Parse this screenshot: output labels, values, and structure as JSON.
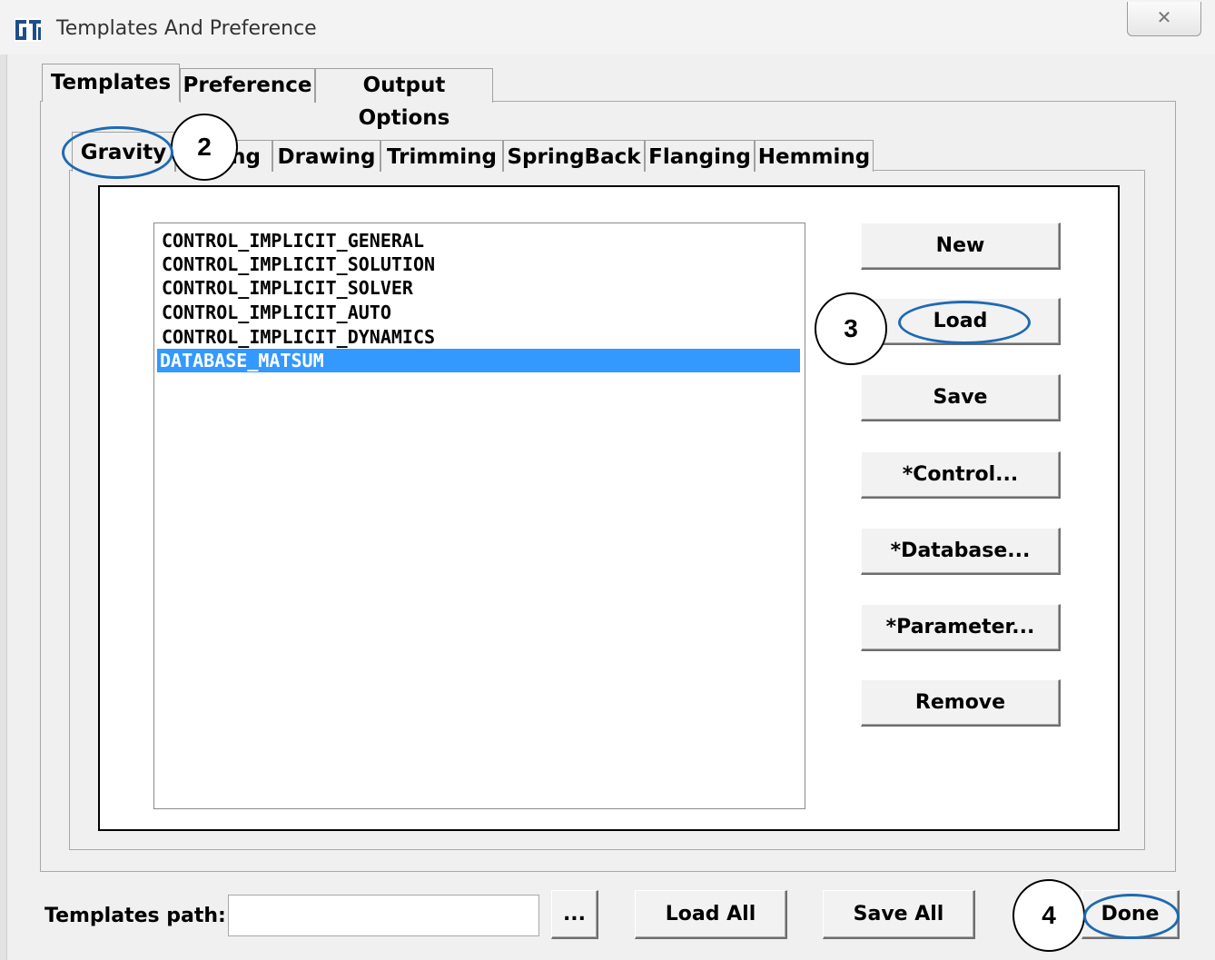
{
  "window": {
    "title": "Templates And Preference",
    "close_glyph": "✕"
  },
  "top_tabs": [
    {
      "label": "Templates",
      "active": true
    },
    {
      "label": "Preference",
      "active": false
    },
    {
      "label": "Output Options",
      "active": false
    }
  ],
  "sub_tabs": [
    {
      "label": "Gravity",
      "active": true
    },
    {
      "label": "ng",
      "active": false
    },
    {
      "label": "Drawing",
      "active": false
    },
    {
      "label": "Trimming",
      "active": false
    },
    {
      "label": "SpringBack",
      "active": false
    },
    {
      "label": "Flanging",
      "active": false
    },
    {
      "label": "Hemming",
      "active": false
    }
  ],
  "template_list": {
    "items": [
      "CONTROL_IMPLICIT_GENERAL",
      "CONTROL_IMPLICIT_SOLUTION",
      "CONTROL_IMPLICIT_SOLVER",
      "CONTROL_IMPLICIT_AUTO",
      "CONTROL_IMPLICIT_DYNAMICS",
      "DATABASE_MATSUM"
    ],
    "selected": "DATABASE_MATSUM"
  },
  "side_buttons": {
    "new": "New",
    "load": "Load",
    "save": "Save",
    "control": "*Control...",
    "database": "*Database...",
    "parameter": "*Parameter...",
    "remove": "Remove"
  },
  "bottom_bar": {
    "path_label": "Templates path:",
    "path_value": "",
    "browse": "...",
    "load_all": "Load All",
    "save_all": "Save All",
    "done": "Done"
  },
  "annotations": {
    "step2": "2",
    "step3": "3",
    "step4": "4",
    "highlight_color": "#1e6ab3"
  },
  "colors": {
    "selection": "#3399ff",
    "icon_blue": "#1e4d8c"
  }
}
